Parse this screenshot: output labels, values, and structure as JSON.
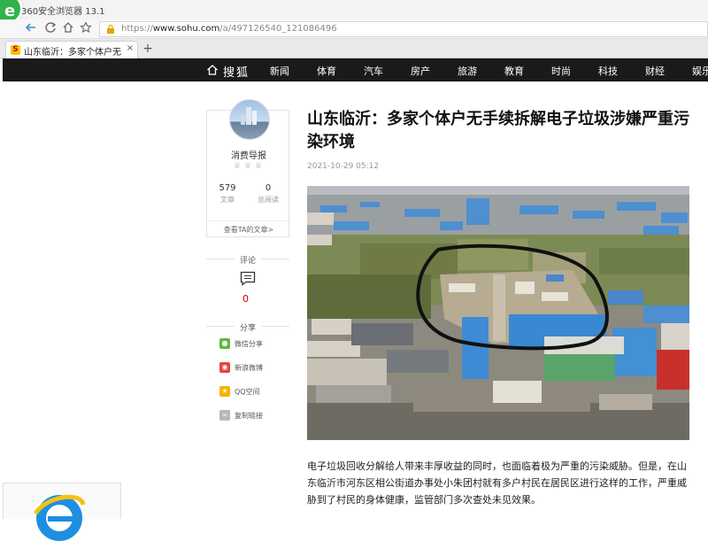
{
  "browser": {
    "title": "360安全浏览器 13.1",
    "url_prefix": "https://",
    "url_domain": "www.sohu.com",
    "url_path": "/a/497126540_121086496",
    "tab_title": "山东临沂：多家个体户无手续拆",
    "tab_close": "×",
    "new_tab": "+"
  },
  "site": {
    "logo": "搜狐",
    "nav": [
      "新闻",
      "体育",
      "汽车",
      "房产",
      "旅游",
      "教育",
      "时尚",
      "科技",
      "财经",
      "娱乐"
    ]
  },
  "author": {
    "name": "消费导报",
    "badges": "♕♕♕",
    "articles_count": "579",
    "articles_label": "文章",
    "reads_count": "0",
    "reads_label": "总阅读",
    "view_articles_link": "查看TA的文章>"
  },
  "comments": {
    "label": "评论",
    "count": "0"
  },
  "share": {
    "label": "分享",
    "items": [
      {
        "label": "微信分享",
        "icon": "wechat-icon",
        "color": "#5dba3b"
      },
      {
        "label": "新浪微博",
        "icon": "weibo-icon",
        "color": "#e4443b"
      },
      {
        "label": "QQ空间",
        "icon": "qzone-icon",
        "color": "#f5b400"
      },
      {
        "label": "复制链接",
        "icon": "link-icon",
        "color": "#b8b8b8"
      }
    ]
  },
  "article": {
    "headline": "山东临沂：多家个体户无手续拆解电子垃圾涉嫌严重污染环境",
    "time": "2021-10-29 05:12",
    "paragraph": "电子垃圾回收分解给人带来丰厚收益的同时，也面临着极为严重的污染威胁。但是，在山东临沂市河东区相公街道办事处小朱团村就有多户村民在居民区进行这样的工作，严重威胁到了村民的身体健康，监管部门多次查处未见效果。"
  },
  "colors": {
    "sohu_nav_bg": "#1a1a1a",
    "browser_green": "#2fb34a",
    "comment_count": "#cc0000"
  }
}
